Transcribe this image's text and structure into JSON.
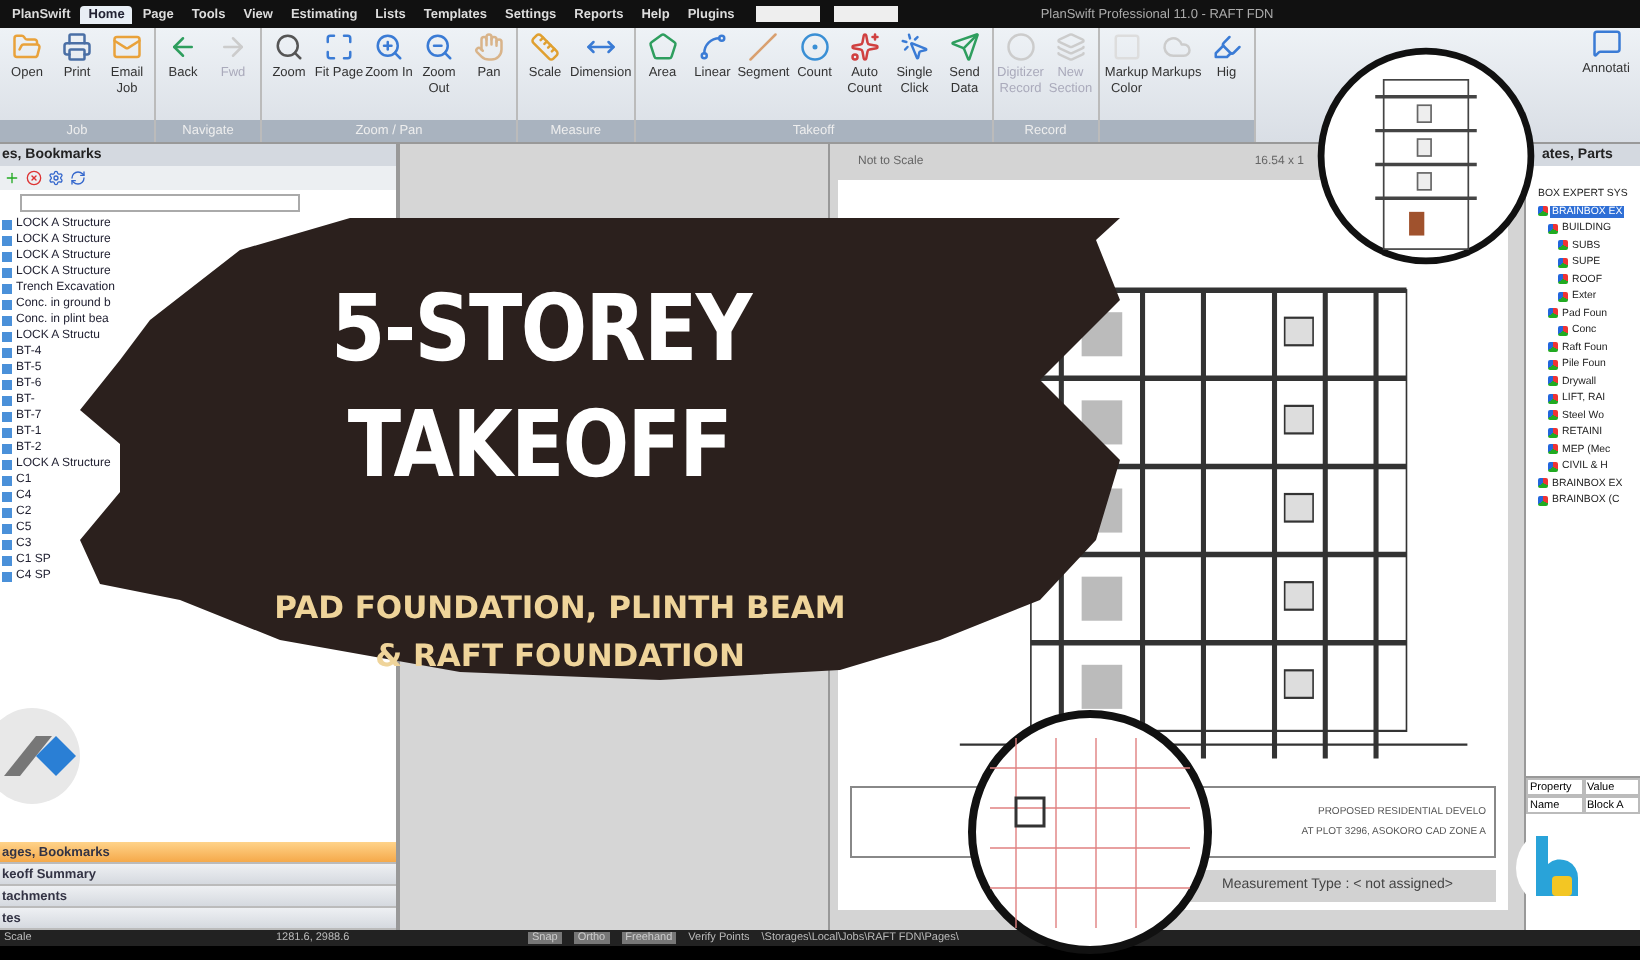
{
  "window": {
    "title": "PlanSwift Professional 11.0 - RAFT FDN"
  },
  "menu": [
    {
      "label": "PlanSwift",
      "selected": false
    },
    {
      "label": "Home",
      "selected": true
    },
    {
      "label": "Page",
      "selected": false
    },
    {
      "label": "Tools",
      "selected": false
    },
    {
      "label": "View",
      "selected": false
    },
    {
      "label": "Estimating",
      "selected": false
    },
    {
      "label": "Lists",
      "selected": false
    },
    {
      "label": "Templates",
      "selected": false
    },
    {
      "label": "Settings",
      "selected": false
    },
    {
      "label": "Reports",
      "selected": false
    },
    {
      "label": "Help",
      "selected": false
    },
    {
      "label": "Plugins",
      "selected": false
    }
  ],
  "ribbon": [
    {
      "title": "Job",
      "buttons": [
        {
          "label": "Open",
          "disabled": false
        },
        {
          "label": "Print",
          "disabled": false
        },
        {
          "label": "Email Job",
          "disabled": false
        }
      ]
    },
    {
      "title": "Navigate",
      "buttons": [
        {
          "label": "Back",
          "disabled": false
        },
        {
          "label": "Fwd",
          "disabled": true
        }
      ]
    },
    {
      "title": "Zoom / Pan",
      "buttons": [
        {
          "label": "Zoom",
          "disabled": false
        },
        {
          "label": "Fit Page",
          "disabled": false
        },
        {
          "label": "Zoom In",
          "disabled": false
        },
        {
          "label": "Zoom Out",
          "disabled": false
        },
        {
          "label": "Pan",
          "disabled": false
        }
      ]
    },
    {
      "title": "Measure",
      "buttons": [
        {
          "label": "Scale",
          "disabled": false
        },
        {
          "label": "Dimension",
          "disabled": false
        }
      ]
    },
    {
      "title": "Takeoff",
      "buttons": [
        {
          "label": "Area",
          "disabled": false
        },
        {
          "label": "Linear",
          "disabled": false
        },
        {
          "label": "Segment",
          "disabled": false
        },
        {
          "label": "Count",
          "disabled": false
        },
        {
          "label": "Auto Count",
          "disabled": false
        },
        {
          "label": "Single Click",
          "disabled": false
        },
        {
          "label": "Send Data",
          "disabled": false
        }
      ]
    },
    {
      "title": "Record",
      "buttons": [
        {
          "label": "Digitizer Record",
          "disabled": true
        },
        {
          "label": "New Section",
          "disabled": true
        }
      ]
    },
    {
      "buttons": [
        {
          "label": "Markup Color",
          "disabled": false
        },
        {
          "label": "Markups",
          "disabled": false
        },
        {
          "label": "Hig",
          "disabled": false
        }
      ]
    }
  ],
  "annotation_button": {
    "label": "Annotati"
  },
  "left_panel": {
    "title": "es, Bookmarks",
    "tree": [
      {
        "label": "LOCK A Structure"
      },
      {
        "label": "LOCK A Structure"
      },
      {
        "label": "LOCK A Structure"
      },
      {
        "label": "LOCK A Structure"
      },
      {
        "label": "Trench Excavation"
      },
      {
        "label": "Conc. in ground b"
      },
      {
        "label": "Conc. in plint bea"
      },
      {
        "label": "LOCK A Structu"
      },
      {
        "label": "BT-4"
      },
      {
        "label": "BT-5"
      },
      {
        "label": "BT-6"
      },
      {
        "label": "BT-"
      },
      {
        "label": "BT-7"
      },
      {
        "label": "BT-1"
      },
      {
        "label": "BT-2"
      },
      {
        "label": "LOCK A Structure"
      },
      {
        "label": "C1"
      },
      {
        "label": "C4"
      },
      {
        "label": "C2"
      },
      {
        "label": "C5"
      },
      {
        "label": "C3"
      },
      {
        "label": "C1 SP"
      },
      {
        "label": "C4 SP"
      }
    ],
    "sections": [
      {
        "label": "ages, Bookmarks",
        "selected": true
      },
      {
        "label": "keoff Summary",
        "selected": false
      },
      {
        "label": "tachments",
        "selected": false
      },
      {
        "label": "tes",
        "selected": false
      }
    ]
  },
  "canvas": {
    "scale_note": "Not to Scale",
    "size": "16.54 x 1",
    "project_label": "PROPOSED RESIDENTIAL DEVELO",
    "location_label": "AT PLOT 3296, ASOKORO CAD ZONE A",
    "measurement_type": "Measurement Type : < not assigned>"
  },
  "right_panel": {
    "title": "ates, Parts",
    "root": "BOX EXPERT SYS",
    "tree": [
      {
        "label": "BRAINBOX EX",
        "selected": true,
        "children": [
          {
            "label": "BUILDING",
            "selected": false,
            "children": [
              {
                "label": "SUBS",
                "selected": false
              },
              {
                "label": "SUPE",
                "selected": false
              },
              {
                "label": "ROOF",
                "selected": false
              },
              {
                "label": "Exter",
                "selected": false
              }
            ]
          },
          {
            "label": "Pad Foun",
            "selected": false,
            "children": [
              {
                "label": "Conc",
                "selected": false
              }
            ]
          },
          {
            "label": "Raft Foun",
            "selected": false
          },
          {
            "label": "Pile Foun",
            "selected": false
          },
          {
            "label": "Drywall",
            "selected": false
          },
          {
            "label": "LIFT, RAI",
            "selected": false
          },
          {
            "label": "Steel Wo",
            "selected": false
          },
          {
            "label": "RETAINI",
            "selected": false
          },
          {
            "label": "MEP (Mec",
            "selected": false
          },
          {
            "label": "CIVIL & H",
            "selected": false
          }
        ]
      },
      {
        "label": "BRAINBOX EX",
        "selected": false
      },
      {
        "label": "BRAINBOX (C",
        "selected": false
      }
    ],
    "properties": [
      [
        "Property",
        "Value"
      ],
      [
        "Name",
        "Block A"
      ]
    ]
  },
  "status_bar": {
    "mode": "Scale",
    "coords": "1281.6, 2988.6",
    "toggles": [
      {
        "label": "Snap",
        "on": false
      },
      {
        "label": "Ortho",
        "on": false
      },
      {
        "label": "Freehand",
        "on": false
      }
    ],
    "verify": "Verify Points",
    "path": "\\Storages\\Local\\Jobs\\RAFT FDN\\Pages\\"
  },
  "overlay": {
    "headline": [
      "5-STOREY",
      "TAKEOFF"
    ],
    "subtitle": [
      "PAD FOUNDATION, PLINTH BEAM",
      "& RAFT FOUNDATION"
    ]
  }
}
